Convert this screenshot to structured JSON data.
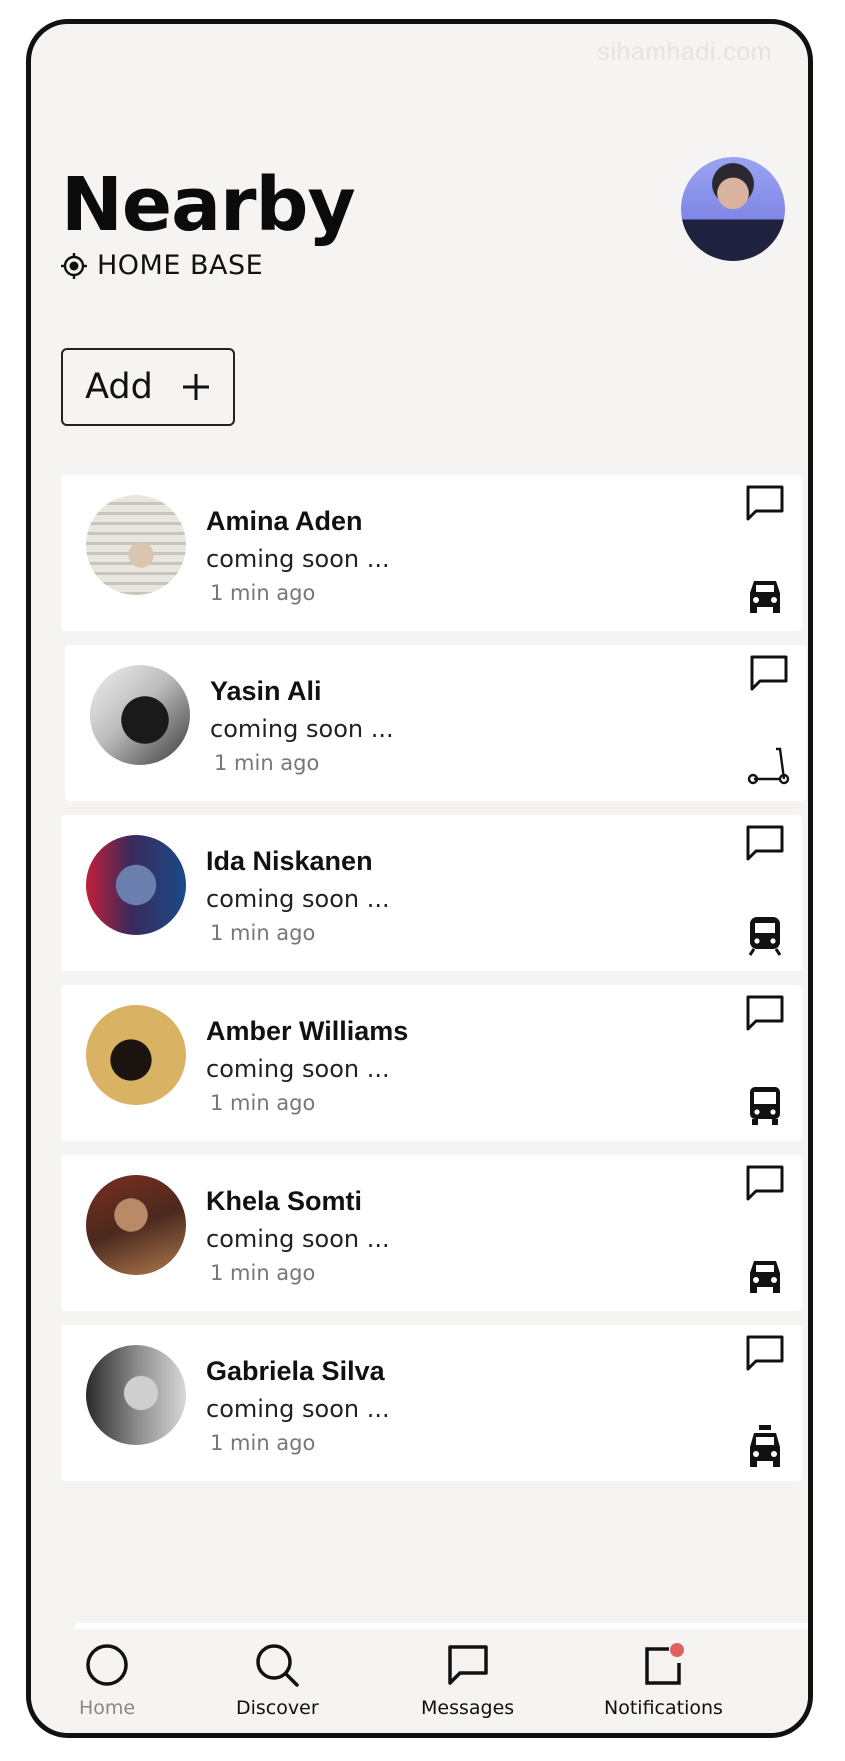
{
  "watermark": "sihamhadi.com",
  "header": {
    "title": "Nearby",
    "location": "HOME BASE"
  },
  "add_button": {
    "label": "Add"
  },
  "contacts": [
    {
      "name": "Amina Aden",
      "status": "coming soon ...",
      "time": "1 min ago",
      "transport": "car-icon"
    },
    {
      "name": "Yasin Ali",
      "status": "coming soon ...",
      "time": "1 min ago",
      "transport": "scooter-icon"
    },
    {
      "name": "Ida Niskanen",
      "status": "coming soon ...",
      "time": "1 min ago",
      "transport": "train-icon"
    },
    {
      "name": "Amber Williams",
      "status": "coming soon ...",
      "time": "1 min ago",
      "transport": "bus-icon"
    },
    {
      "name": "Khela Somti",
      "status": "coming soon ...",
      "time": "1 min ago",
      "transport": "car-icon"
    },
    {
      "name": "Gabriela Silva",
      "status": "coming soon ...",
      "time": "1 min ago",
      "transport": "taxi-icon"
    }
  ],
  "nav": [
    {
      "label": "Home",
      "icon": "home-circle-icon"
    },
    {
      "label": "Discover",
      "icon": "search-icon"
    },
    {
      "label": "Messages",
      "icon": "message-icon"
    },
    {
      "label": "Notifications",
      "icon": "notification-icon"
    }
  ],
  "colors": {
    "background": "#f5f4f2",
    "card": "#ffffff",
    "text": "#111111",
    "notification_dot": "#e0625f"
  }
}
